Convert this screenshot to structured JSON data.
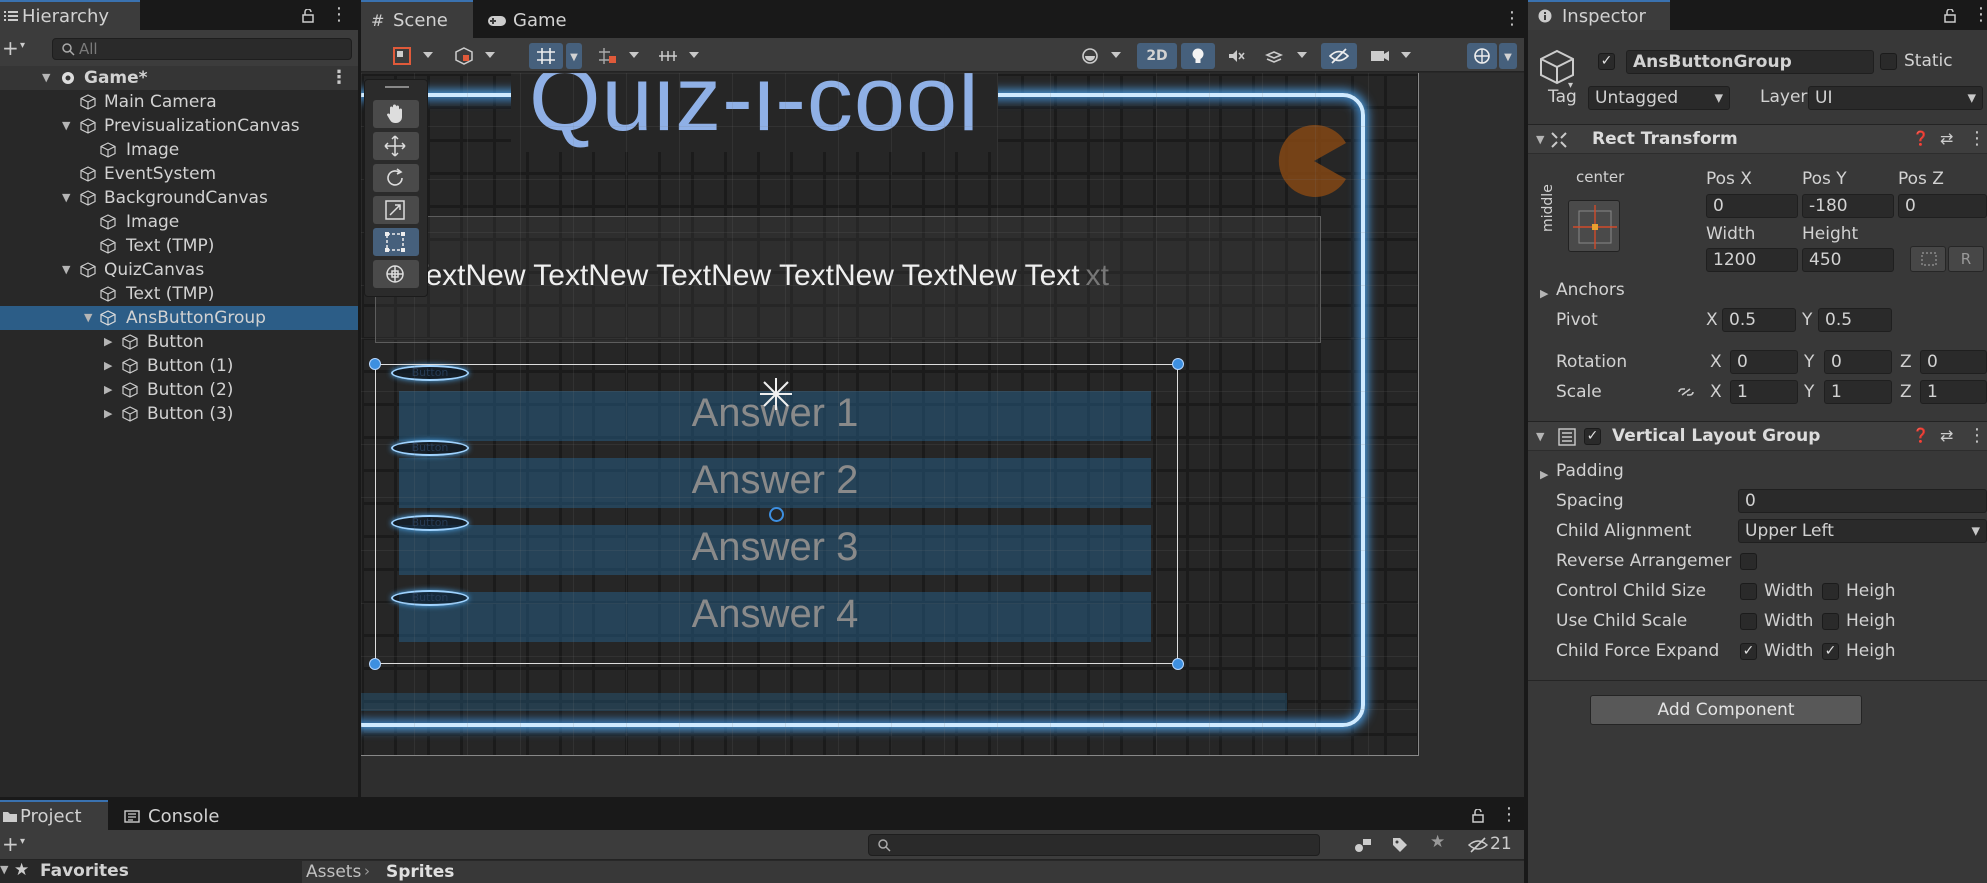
{
  "hierarchy": {
    "tab_label": "Hierarchy",
    "search_placeholder": "All",
    "items": [
      {
        "label": "Game*"
      },
      {
        "label": "Main Camera"
      },
      {
        "label": "PrevisualizationCanvas"
      },
      {
        "label": "Image"
      },
      {
        "label": "EventSystem"
      },
      {
        "label": "BackgroundCanvas"
      },
      {
        "label": "Image"
      },
      {
        "label": "Text (TMP)"
      },
      {
        "label": "QuizCanvas"
      },
      {
        "label": "Text (TMP)"
      },
      {
        "label": "AnsButtonGroup"
      },
      {
        "label": "Button"
      },
      {
        "label": "Button (1)"
      },
      {
        "label": "Button (2)"
      },
      {
        "label": "Button (3)"
      }
    ]
  },
  "scene": {
    "tabs": [
      {
        "label": "Scene"
      },
      {
        "label": "Game"
      }
    ],
    "toolbar": {
      "mode_2d": "2D"
    },
    "title_text": "Quiz-i-cool",
    "question_text": "w TextNew TextNew TextNew TextNew TextNew Text",
    "question_ghost": "xt",
    "answers": [
      "Answer 1",
      "Answer 2",
      "Answer 3",
      "Answer 4"
    ],
    "button_label": "Button"
  },
  "inspector": {
    "tab_label": "Inspector",
    "object_name": "AnsButtonGroup",
    "static_label": "Static",
    "tag_label": "Tag",
    "tag_value": "Untagged",
    "layer_label": "Layer",
    "layer_value": "UI",
    "rect_transform": {
      "title": "Rect Transform",
      "anchor_h": "center",
      "anchor_v": "middle",
      "pos_x_label": "Pos X",
      "pos_x": "0",
      "pos_y_label": "Pos Y",
      "pos_y": "-180",
      "pos_z_label": "Pos Z",
      "pos_z": "0",
      "width_label": "Width",
      "width": "1200",
      "height_label": "Height",
      "height": "450",
      "r_button": "R",
      "anchors_label": "Anchors",
      "pivot_label": "Pivot",
      "pivot_x": "0.5",
      "pivot_y": "0.5",
      "rotation_label": "Rotation",
      "rot_x": "0",
      "rot_y": "0",
      "rot_z": "0",
      "scale_label": "Scale",
      "scale_x": "1",
      "scale_y": "1",
      "scale_z": "1",
      "x": "X",
      "y": "Y",
      "z": "Z"
    },
    "vlg": {
      "title": "Vertical Layout Group",
      "padding_label": "Padding",
      "spacing_label": "Spacing",
      "spacing": "0",
      "child_alignment_label": "Child Alignment",
      "child_alignment": "Upper Left",
      "reverse_label": "Reverse Arrangemer",
      "control_label": "Control Child Size",
      "use_scale_label": "Use Child Scale",
      "force_label": "Child Force Expand",
      "width_label": "Width",
      "height_label": "Heigh"
    },
    "add_component": "Add Component"
  },
  "bottom": {
    "tabs": [
      {
        "label": "Project"
      },
      {
        "label": "Console"
      }
    ],
    "favorites_label": "Favorites",
    "breadcrumb": [
      "Assets",
      "Sprites"
    ],
    "hidden_count": "21"
  },
  "colors": {
    "selection": "#2c5d87",
    "accent": "#3a72b0",
    "neon": "#4a9be0"
  }
}
